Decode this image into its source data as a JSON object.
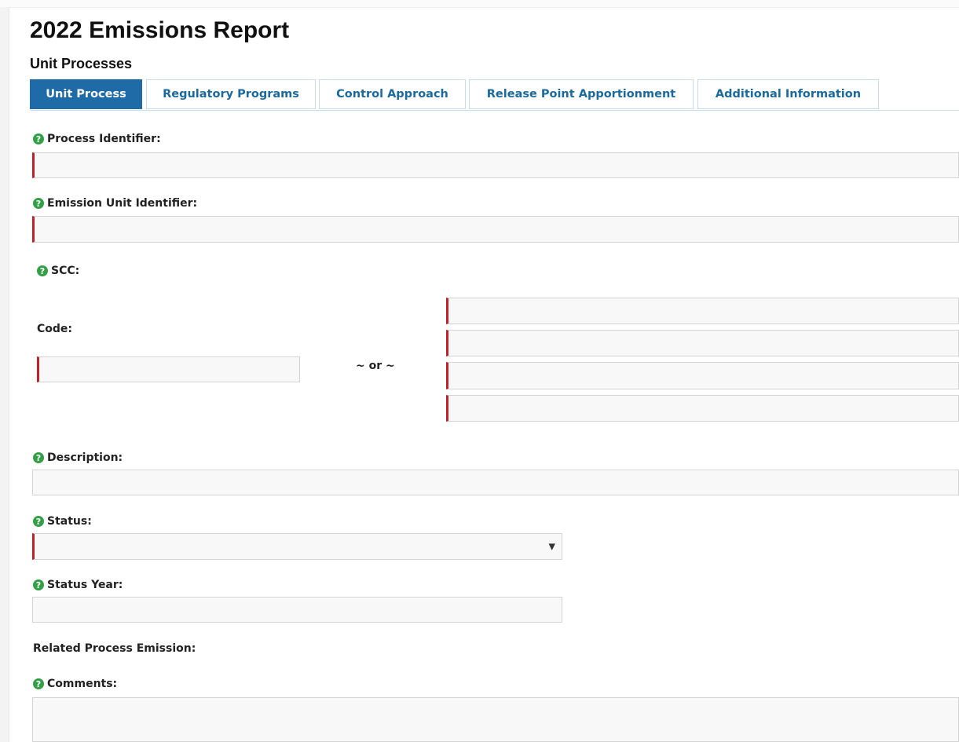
{
  "page": {
    "title": "2022 Emissions Report",
    "subtitle": "Unit Processes"
  },
  "tabs": [
    {
      "label": "Unit Process",
      "active": true
    },
    {
      "label": "Regulatory Programs",
      "active": false
    },
    {
      "label": "Control Approach",
      "active": false
    },
    {
      "label": "Release Point Apportionment",
      "active": false
    },
    {
      "label": "Additional Information",
      "active": false
    }
  ],
  "help_icon_glyph": "?",
  "fields": {
    "process_identifier": {
      "label": "Process Identifier:",
      "value": ""
    },
    "emission_unit_identifier": {
      "label": "Emission Unit Identifier:",
      "value": ""
    },
    "scc": {
      "label": "SCC:",
      "code_label": "Code:",
      "code_value": "",
      "or_text": "~ or ~",
      "levels": [
        "",
        "",
        "",
        ""
      ]
    },
    "description": {
      "label": "Description:",
      "value": ""
    },
    "status": {
      "label": "Status:",
      "selected": ""
    },
    "status_year": {
      "label": "Status Year:",
      "value": ""
    },
    "related_process_emission": {
      "label": "Related Process Emission:"
    },
    "comments": {
      "label": "Comments:",
      "value": ""
    }
  },
  "colors": {
    "tab_active_bg": "#1f6ba8",
    "tab_text": "#1a6aa0",
    "required_marker": "#c0202a",
    "help_icon": "#33a047"
  }
}
